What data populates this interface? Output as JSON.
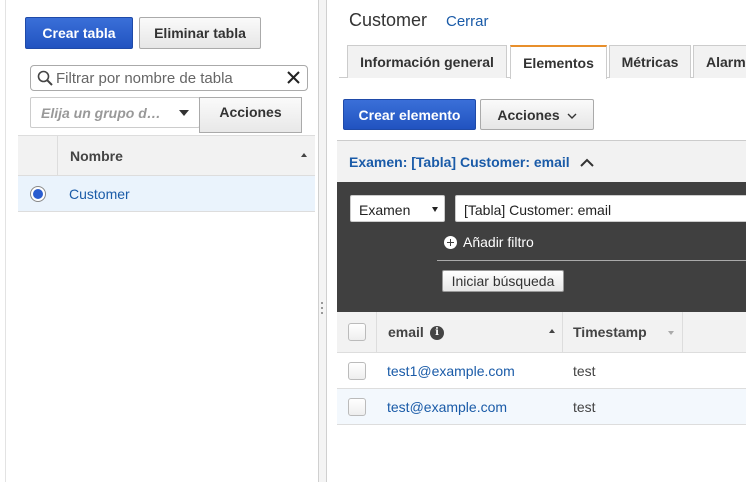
{
  "left": {
    "create_table": "Crear tabla",
    "delete_table": "Eliminar tabla",
    "filter_placeholder": "Filtrar por nombre de tabla",
    "group_placeholder": "Elija un grupo d…",
    "actions": "Acciones",
    "table": {
      "header": "Nombre",
      "rows": [
        {
          "name": "Customer",
          "selected": true
        }
      ]
    }
  },
  "right": {
    "title": "Customer",
    "close": "Cerrar",
    "tabs": [
      {
        "label": "Información general",
        "active": false
      },
      {
        "label": "Elementos",
        "active": true
      },
      {
        "label": "Métricas",
        "active": false
      },
      {
        "label": "Alarm",
        "active": false
      }
    ],
    "create_item": "Crear elemento",
    "actions": "Acciones",
    "scan": {
      "header": "Examen: [Tabla] Customer: email",
      "mode": "Examen",
      "target": "[Tabla] Customer: email",
      "add_filter": "Añadir filtro",
      "start_search": "Iniciar búsqueda"
    },
    "items": {
      "columns": [
        "email",
        "Timestamp"
      ],
      "rows": [
        {
          "email": "test1@example.com",
          "timestamp": "test"
        },
        {
          "email": "test@example.com",
          "timestamp": "test"
        }
      ]
    }
  },
  "colors": {
    "primary": "#2a5dd0",
    "link": "#1a5ba8",
    "active_tab_accent": "#e88f2b",
    "filter_bg": "#404040",
    "selected_row_bg": "#eaf3fc"
  }
}
